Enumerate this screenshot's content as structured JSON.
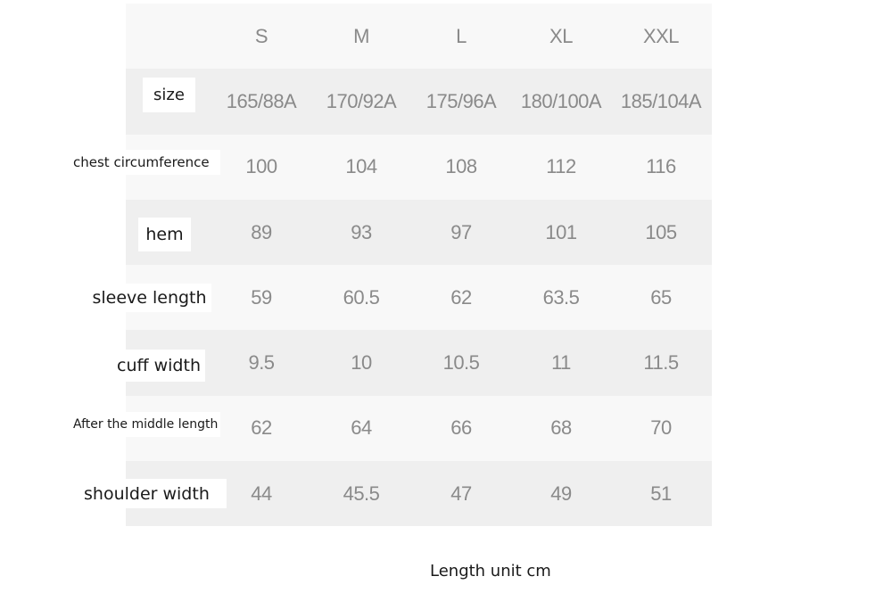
{
  "table": {
    "columns": [
      "S",
      "M",
      "L",
      "XL",
      "XXL"
    ],
    "rows": [
      {
        "label": "size",
        "values": [
          "165/88A",
          "170/92A",
          "175/96A",
          "180/100A",
          "185/104A"
        ]
      },
      {
        "label": "chest circumference",
        "values": [
          "100",
          "104",
          "108",
          "112",
          "116"
        ]
      },
      {
        "label": "hem",
        "values": [
          "89",
          "93",
          "97",
          "101",
          "105"
        ]
      },
      {
        "label": "sleeve length",
        "values": [
          "59",
          "60.5",
          "62",
          "63.5",
          "65"
        ]
      },
      {
        "label": "cuff width",
        "values": [
          "9.5",
          "10",
          "10.5",
          "11",
          "11.5"
        ]
      },
      {
        "label": "After the middle length",
        "values": [
          "62",
          "64",
          "66",
          "68",
          "70"
        ]
      },
      {
        "label": "shoulder width",
        "values": [
          "44",
          "45.5",
          "47",
          "49",
          "51"
        ]
      }
    ]
  },
  "footer": {
    "note": "Length unit cm"
  }
}
